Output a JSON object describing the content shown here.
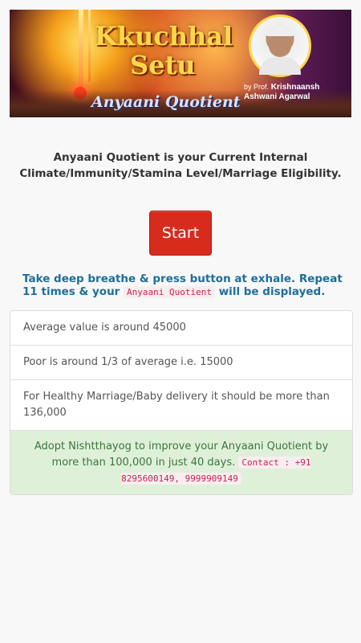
{
  "banner": {
    "brand_line1": "Kkuchhal",
    "brand_line2": "Setu",
    "subtitle": "Anyaani Quotient",
    "by": "by Prof.",
    "author_line1": "Krishnaansh",
    "author_line2": "Ashwani Agarwal"
  },
  "intro_text": "Anyaani Quotient is your Current Internal Climate/Immunity/Stamina Level/Marriage Eligibility.",
  "start_label": "Start",
  "instruction": {
    "before": "Take deep breathe & press button at exhale. Repeat 11 times & your ",
    "code": "Anyaani Quotient",
    "after": " will be displayed."
  },
  "items": [
    "Average value is around 45000",
    "Poor is around 1/3 of average i.e. 15000",
    "For Healthy Marriage/Baby delivery it should be more than 136,000"
  ],
  "promo": {
    "text": "Adopt Nishtthayog to improve your Anyaani Quotient by more than 100,000 in just 40 days. ",
    "contact": "Contact : +91 8295600149, 9999909149"
  },
  "colors": {
    "button": "#d72b1c",
    "instruction": "#1f6e9a",
    "success_bg": "#dff0d8",
    "success_text": "#3c763d"
  }
}
